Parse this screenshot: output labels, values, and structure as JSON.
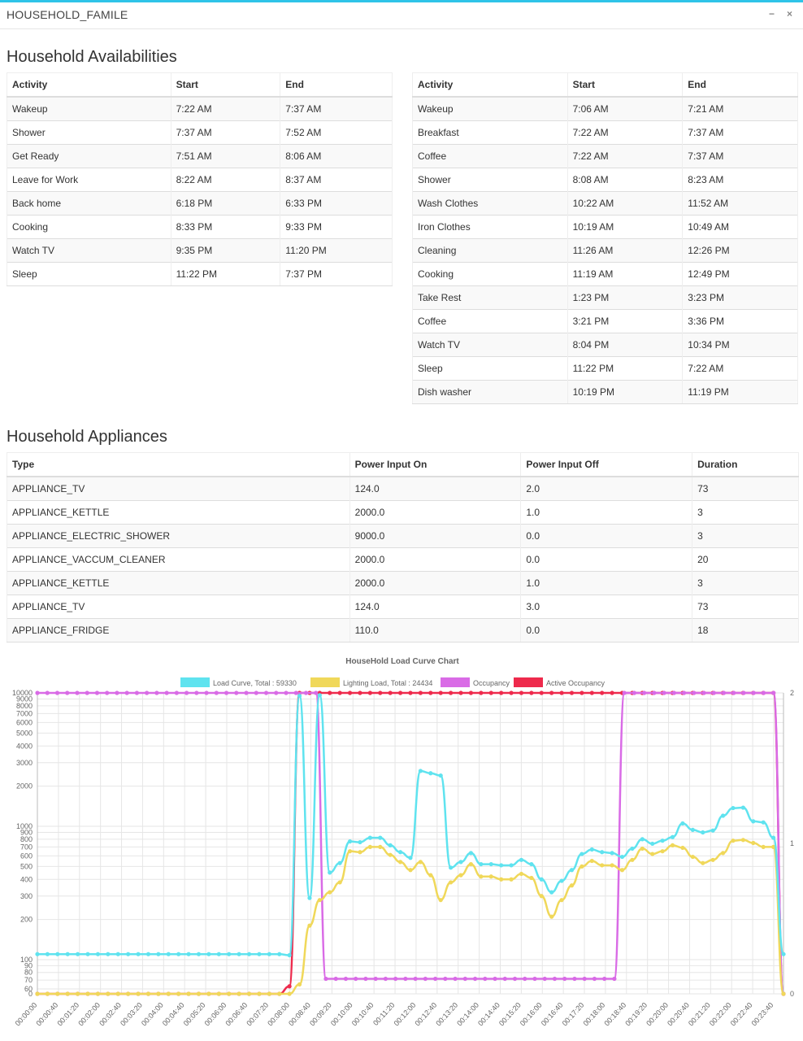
{
  "window": {
    "title": "HOUSEHOLD_FAMILE",
    "minimize_label": "−",
    "close_label": "×"
  },
  "availabilities": {
    "heading": "Household Availabilities",
    "columns": [
      "Activity",
      "Start",
      "End"
    ],
    "left_rows": [
      [
        "Wakeup",
        "7:22 AM",
        "7:37 AM"
      ],
      [
        "Shower",
        "7:37 AM",
        "7:52 AM"
      ],
      [
        "Get Ready",
        "7:51 AM",
        "8:06 AM"
      ],
      [
        "Leave for Work",
        "8:22 AM",
        "8:37 AM"
      ],
      [
        "Back home",
        "6:18 PM",
        "6:33 PM"
      ],
      [
        "Cooking",
        "8:33 PM",
        "9:33 PM"
      ],
      [
        "Watch TV",
        "9:35 PM",
        "11:20 PM"
      ],
      [
        "Sleep",
        "11:22 PM",
        "7:37 PM"
      ]
    ],
    "right_rows": [
      [
        "Wakeup",
        "7:06 AM",
        "7:21 AM"
      ],
      [
        "Breakfast",
        "7:22 AM",
        "7:37 AM"
      ],
      [
        "Coffee",
        "7:22 AM",
        "7:37 AM"
      ],
      [
        "Shower",
        "8:08 AM",
        "8:23 AM"
      ],
      [
        "Wash Clothes",
        "10:22 AM",
        "11:52 AM"
      ],
      [
        "Iron Clothes",
        "10:19 AM",
        "10:49 AM"
      ],
      [
        "Cleaning",
        "11:26 AM",
        "12:26 PM"
      ],
      [
        "Cooking",
        "11:19 AM",
        "12:49 PM"
      ],
      [
        "Take Rest",
        "1:23 PM",
        "3:23 PM"
      ],
      [
        "Coffee",
        "3:21 PM",
        "3:36 PM"
      ],
      [
        "Watch TV",
        "8:04 PM",
        "10:34 PM"
      ],
      [
        "Sleep",
        "11:22 PM",
        "7:22 AM"
      ],
      [
        "Dish washer",
        "10:19 PM",
        "11:19 PM"
      ]
    ]
  },
  "appliances": {
    "heading": "Household Appliances",
    "columns": [
      "Type",
      "Power Input On",
      "Power Input Off",
      "Duration"
    ],
    "rows": [
      [
        "APPLIANCE_TV",
        "124.0",
        "2.0",
        "73"
      ],
      [
        "APPLIANCE_KETTLE",
        "2000.0",
        "1.0",
        "3"
      ],
      [
        "APPLIANCE_ELECTRIC_SHOWER",
        "9000.0",
        "0.0",
        "3"
      ],
      [
        "APPLIANCE_VACCUM_CLEANER",
        "2000.0",
        "0.0",
        "20"
      ],
      [
        "APPLIANCE_KETTLE",
        "2000.0",
        "1.0",
        "3"
      ],
      [
        "APPLIANCE_TV",
        "124.0",
        "3.0",
        "73"
      ],
      [
        "APPLIANCE_FRIDGE",
        "110.0",
        "0.0",
        "18"
      ]
    ]
  },
  "chart_data": {
    "type": "line",
    "title": "HouseHold Load Curve Chart",
    "y_scale": "log",
    "legend_position": "top-center",
    "y_ticks": [
      "0",
      "60",
      "70",
      "80",
      "90",
      "100",
      "200",
      "300",
      "400",
      "500",
      "600",
      "700",
      "800",
      "900",
      "1000",
      "2000",
      "3000",
      "4000",
      "5000",
      "6000",
      "7000",
      "8000",
      "9000",
      "10000"
    ],
    "y_tick_values": [
      0,
      60,
      70,
      80,
      90,
      100,
      200,
      300,
      400,
      500,
      600,
      700,
      800,
      900,
      1000,
      2000,
      3000,
      4000,
      5000,
      6000,
      7000,
      8000,
      9000,
      10000
    ],
    "y2_ticks": [
      "0",
      "1",
      "2"
    ],
    "y2_range": [
      0,
      2
    ],
    "x_ticks": [
      "00:00:00",
      "00:00:40",
      "00:01:20",
      "00:02:00",
      "00:02:40",
      "00:03:20",
      "00:04:00",
      "00:04:40",
      "00:05:20",
      "00:06:00",
      "00:06:40",
      "00:07:20",
      "00:08:00",
      "00:08:40",
      "00:09:20",
      "00:10:00",
      "00:10:40",
      "00:11:20",
      "00:12:00",
      "00:12:40",
      "00:13:20",
      "00:14:00",
      "00:14:40",
      "00:15:20",
      "00:16:00",
      "00:16:40",
      "00:17:20",
      "00:18:00",
      "00:18:40",
      "00:19:20",
      "00:20:00",
      "00:20:40",
      "00:21:20",
      "00:22:00",
      "00:22:40",
      "00:23:40"
    ],
    "series": [
      {
        "name": "Load Curve, Total : 59330",
        "color": "#5fe3ef",
        "axis": "left",
        "values": [
          110,
          110,
          110,
          110,
          110,
          110,
          110,
          110,
          110,
          110,
          110,
          110,
          110,
          110,
          110,
          110,
          110,
          110,
          110,
          110,
          110,
          110,
          110,
          110,
          110,
          108,
          9500,
          290,
          9600,
          450,
          530,
          770,
          760,
          820,
          820,
          720,
          640,
          580,
          2600,
          2500,
          2400,
          490,
          540,
          630,
          520,
          520,
          510,
          510,
          560,
          520,
          400,
          320,
          390,
          470,
          620,
          670,
          640,
          630,
          590,
          680,
          800,
          740,
          780,
          830,
          1050,
          940,
          900,
          930,
          1200,
          1370,
          1380,
          1090,
          1070,
          820,
          110
        ]
      },
      {
        "name": "Lighting Load, Total : 24434",
        "color": "#f0d85a",
        "axis": "left",
        "values": [
          0,
          0,
          0,
          0,
          0,
          0,
          0,
          0,
          0,
          0,
          0,
          0,
          0,
          0,
          0,
          0,
          0,
          0,
          0,
          0,
          0,
          0,
          0,
          0,
          0,
          0,
          65,
          180,
          280,
          320,
          380,
          650,
          640,
          700,
          700,
          610,
          540,
          470,
          540,
          430,
          280,
          380,
          430,
          520,
          420,
          420,
          400,
          400,
          440,
          410,
          300,
          210,
          280,
          360,
          500,
          550,
          510,
          510,
          470,
          560,
          680,
          620,
          650,
          720,
          690,
          590,
          530,
          560,
          630,
          780,
          790,
          750,
          700,
          700,
          0
        ]
      },
      {
        "name": "Occupancy",
        "color": "#d96be6",
        "axis": "right",
        "values": [
          2,
          2,
          2,
          2,
          2,
          2,
          2,
          2,
          2,
          2,
          2,
          2,
          2,
          2,
          2,
          2,
          2,
          2,
          2,
          2,
          2,
          2,
          2,
          2,
          2,
          2,
          2,
          2,
          2,
          0.1,
          0.1,
          0.1,
          0.1,
          0.1,
          0.1,
          0.1,
          0.1,
          0.1,
          0.1,
          0.1,
          0.1,
          0.1,
          0.1,
          0.1,
          0.1,
          0.1,
          0.1,
          0.1,
          0.1,
          0.1,
          0.1,
          0.1,
          0.1,
          0.1,
          0.1,
          0.1,
          0.1,
          0.1,
          0.1,
          2,
          2,
          2,
          2,
          2,
          2,
          2,
          2,
          2,
          2,
          2,
          2,
          2,
          2,
          2,
          2,
          0
        ]
      },
      {
        "name": "Active Occupancy",
        "color": "#ee2a4c",
        "axis": "right",
        "values": [
          0,
          0,
          0,
          0,
          0,
          0,
          0,
          0,
          0,
          0,
          0,
          0,
          0,
          0,
          0,
          0,
          0,
          0,
          0,
          0,
          0,
          0,
          0,
          0,
          0,
          0.05,
          2,
          2,
          2,
          2,
          2,
          2,
          2,
          2,
          2,
          2,
          2,
          2,
          2,
          2,
          2,
          2,
          2,
          2,
          2,
          2,
          2,
          2,
          2,
          2,
          2,
          2,
          2,
          2,
          2,
          2,
          2,
          2,
          2,
          2,
          2,
          2,
          2,
          2,
          2,
          2,
          2,
          2,
          2,
          2,
          2,
          2,
          2,
          2,
          0
        ]
      }
    ]
  }
}
